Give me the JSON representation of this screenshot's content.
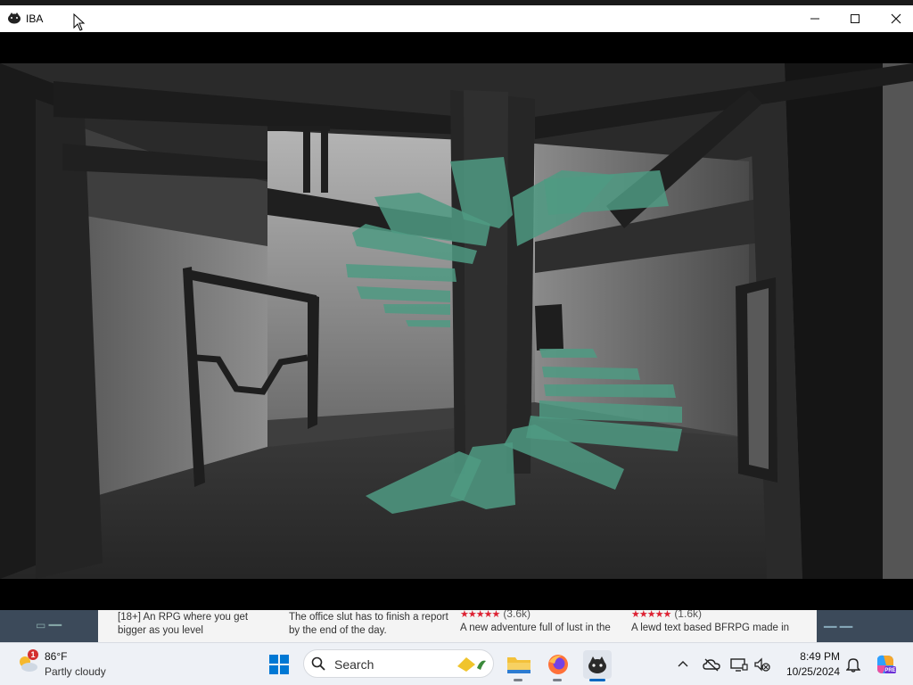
{
  "window": {
    "title": "IBA",
    "controls": [
      "minimize-icon",
      "maximize-icon",
      "close-icon"
    ]
  },
  "game": {
    "scene": "3d-room-spiral-staircase",
    "colors": {
      "stairs": "#4f9a83",
      "walls": "#6a6a6a",
      "frames": "#1e1e1e"
    }
  },
  "background_browser": {
    "cards": [
      {
        "text": "[18+] An RPG where you get bigger as you level"
      },
      {
        "text": "The office slut has to finish a report by the end of the day."
      },
      {
        "stars": "★★★★★",
        "rating": "(3.6k)",
        "text": "A new adventure full of lust in the"
      },
      {
        "stars": "★★★★★",
        "rating": "(1.6k)",
        "text": "A lewd text based BFRPG made in"
      }
    ]
  },
  "taskbar": {
    "weather": {
      "temp": "86°F",
      "condition": "Partly cloudy",
      "badge": "1"
    },
    "search_placeholder": "Search",
    "apps": [
      "windows-start-icon",
      "file-explorer-icon",
      "firefox-icon",
      "game-app-icon"
    ],
    "tray": [
      "chevron-up-icon",
      "onedrive-icon",
      "display-icon",
      "volume-muted-icon"
    ],
    "time": "8:49 PM",
    "date": "10/25/2024",
    "colors": {
      "accent": "#0067c0"
    }
  }
}
